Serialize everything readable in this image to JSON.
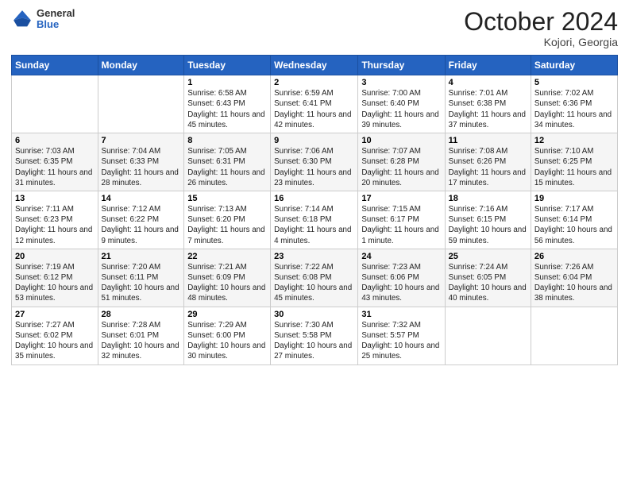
{
  "logo": {
    "general": "General",
    "blue": "Blue"
  },
  "title": "October 2024",
  "location": "Kojori, Georgia",
  "days_of_week": [
    "Sunday",
    "Monday",
    "Tuesday",
    "Wednesday",
    "Thursday",
    "Friday",
    "Saturday"
  ],
  "weeks": [
    [
      {
        "day": "",
        "sunrise": "",
        "sunset": "",
        "daylight": "",
        "empty": true
      },
      {
        "day": "",
        "sunrise": "",
        "sunset": "",
        "daylight": "",
        "empty": true
      },
      {
        "day": "1",
        "sunrise": "Sunrise: 6:58 AM",
        "sunset": "Sunset: 6:43 PM",
        "daylight": "Daylight: 11 hours and 45 minutes."
      },
      {
        "day": "2",
        "sunrise": "Sunrise: 6:59 AM",
        "sunset": "Sunset: 6:41 PM",
        "daylight": "Daylight: 11 hours and 42 minutes."
      },
      {
        "day": "3",
        "sunrise": "Sunrise: 7:00 AM",
        "sunset": "Sunset: 6:40 PM",
        "daylight": "Daylight: 11 hours and 39 minutes."
      },
      {
        "day": "4",
        "sunrise": "Sunrise: 7:01 AM",
        "sunset": "Sunset: 6:38 PM",
        "daylight": "Daylight: 11 hours and 37 minutes."
      },
      {
        "day": "5",
        "sunrise": "Sunrise: 7:02 AM",
        "sunset": "Sunset: 6:36 PM",
        "daylight": "Daylight: 11 hours and 34 minutes."
      }
    ],
    [
      {
        "day": "6",
        "sunrise": "Sunrise: 7:03 AM",
        "sunset": "Sunset: 6:35 PM",
        "daylight": "Daylight: 11 hours and 31 minutes."
      },
      {
        "day": "7",
        "sunrise": "Sunrise: 7:04 AM",
        "sunset": "Sunset: 6:33 PM",
        "daylight": "Daylight: 11 hours and 28 minutes."
      },
      {
        "day": "8",
        "sunrise": "Sunrise: 7:05 AM",
        "sunset": "Sunset: 6:31 PM",
        "daylight": "Daylight: 11 hours and 26 minutes."
      },
      {
        "day": "9",
        "sunrise": "Sunrise: 7:06 AM",
        "sunset": "Sunset: 6:30 PM",
        "daylight": "Daylight: 11 hours and 23 minutes."
      },
      {
        "day": "10",
        "sunrise": "Sunrise: 7:07 AM",
        "sunset": "Sunset: 6:28 PM",
        "daylight": "Daylight: 11 hours and 20 minutes."
      },
      {
        "day": "11",
        "sunrise": "Sunrise: 7:08 AM",
        "sunset": "Sunset: 6:26 PM",
        "daylight": "Daylight: 11 hours and 17 minutes."
      },
      {
        "day": "12",
        "sunrise": "Sunrise: 7:10 AM",
        "sunset": "Sunset: 6:25 PM",
        "daylight": "Daylight: 11 hours and 15 minutes."
      }
    ],
    [
      {
        "day": "13",
        "sunrise": "Sunrise: 7:11 AM",
        "sunset": "Sunset: 6:23 PM",
        "daylight": "Daylight: 11 hours and 12 minutes."
      },
      {
        "day": "14",
        "sunrise": "Sunrise: 7:12 AM",
        "sunset": "Sunset: 6:22 PM",
        "daylight": "Daylight: 11 hours and 9 minutes."
      },
      {
        "day": "15",
        "sunrise": "Sunrise: 7:13 AM",
        "sunset": "Sunset: 6:20 PM",
        "daylight": "Daylight: 11 hours and 7 minutes."
      },
      {
        "day": "16",
        "sunrise": "Sunrise: 7:14 AM",
        "sunset": "Sunset: 6:18 PM",
        "daylight": "Daylight: 11 hours and 4 minutes."
      },
      {
        "day": "17",
        "sunrise": "Sunrise: 7:15 AM",
        "sunset": "Sunset: 6:17 PM",
        "daylight": "Daylight: 11 hours and 1 minute."
      },
      {
        "day": "18",
        "sunrise": "Sunrise: 7:16 AM",
        "sunset": "Sunset: 6:15 PM",
        "daylight": "Daylight: 10 hours and 59 minutes."
      },
      {
        "day": "19",
        "sunrise": "Sunrise: 7:17 AM",
        "sunset": "Sunset: 6:14 PM",
        "daylight": "Daylight: 10 hours and 56 minutes."
      }
    ],
    [
      {
        "day": "20",
        "sunrise": "Sunrise: 7:19 AM",
        "sunset": "Sunset: 6:12 PM",
        "daylight": "Daylight: 10 hours and 53 minutes."
      },
      {
        "day": "21",
        "sunrise": "Sunrise: 7:20 AM",
        "sunset": "Sunset: 6:11 PM",
        "daylight": "Daylight: 10 hours and 51 minutes."
      },
      {
        "day": "22",
        "sunrise": "Sunrise: 7:21 AM",
        "sunset": "Sunset: 6:09 PM",
        "daylight": "Daylight: 10 hours and 48 minutes."
      },
      {
        "day": "23",
        "sunrise": "Sunrise: 7:22 AM",
        "sunset": "Sunset: 6:08 PM",
        "daylight": "Daylight: 10 hours and 45 minutes."
      },
      {
        "day": "24",
        "sunrise": "Sunrise: 7:23 AM",
        "sunset": "Sunset: 6:06 PM",
        "daylight": "Daylight: 10 hours and 43 minutes."
      },
      {
        "day": "25",
        "sunrise": "Sunrise: 7:24 AM",
        "sunset": "Sunset: 6:05 PM",
        "daylight": "Daylight: 10 hours and 40 minutes."
      },
      {
        "day": "26",
        "sunrise": "Sunrise: 7:26 AM",
        "sunset": "Sunset: 6:04 PM",
        "daylight": "Daylight: 10 hours and 38 minutes."
      }
    ],
    [
      {
        "day": "27",
        "sunrise": "Sunrise: 7:27 AM",
        "sunset": "Sunset: 6:02 PM",
        "daylight": "Daylight: 10 hours and 35 minutes."
      },
      {
        "day": "28",
        "sunrise": "Sunrise: 7:28 AM",
        "sunset": "Sunset: 6:01 PM",
        "daylight": "Daylight: 10 hours and 32 minutes."
      },
      {
        "day": "29",
        "sunrise": "Sunrise: 7:29 AM",
        "sunset": "Sunset: 6:00 PM",
        "daylight": "Daylight: 10 hours and 30 minutes."
      },
      {
        "day": "30",
        "sunrise": "Sunrise: 7:30 AM",
        "sunset": "Sunset: 5:58 PM",
        "daylight": "Daylight: 10 hours and 27 minutes."
      },
      {
        "day": "31",
        "sunrise": "Sunrise: 7:32 AM",
        "sunset": "Sunset: 5:57 PM",
        "daylight": "Daylight: 10 hours and 25 minutes."
      },
      {
        "day": "",
        "sunrise": "",
        "sunset": "",
        "daylight": "",
        "empty": true
      },
      {
        "day": "",
        "sunrise": "",
        "sunset": "",
        "daylight": "",
        "empty": true
      }
    ]
  ]
}
